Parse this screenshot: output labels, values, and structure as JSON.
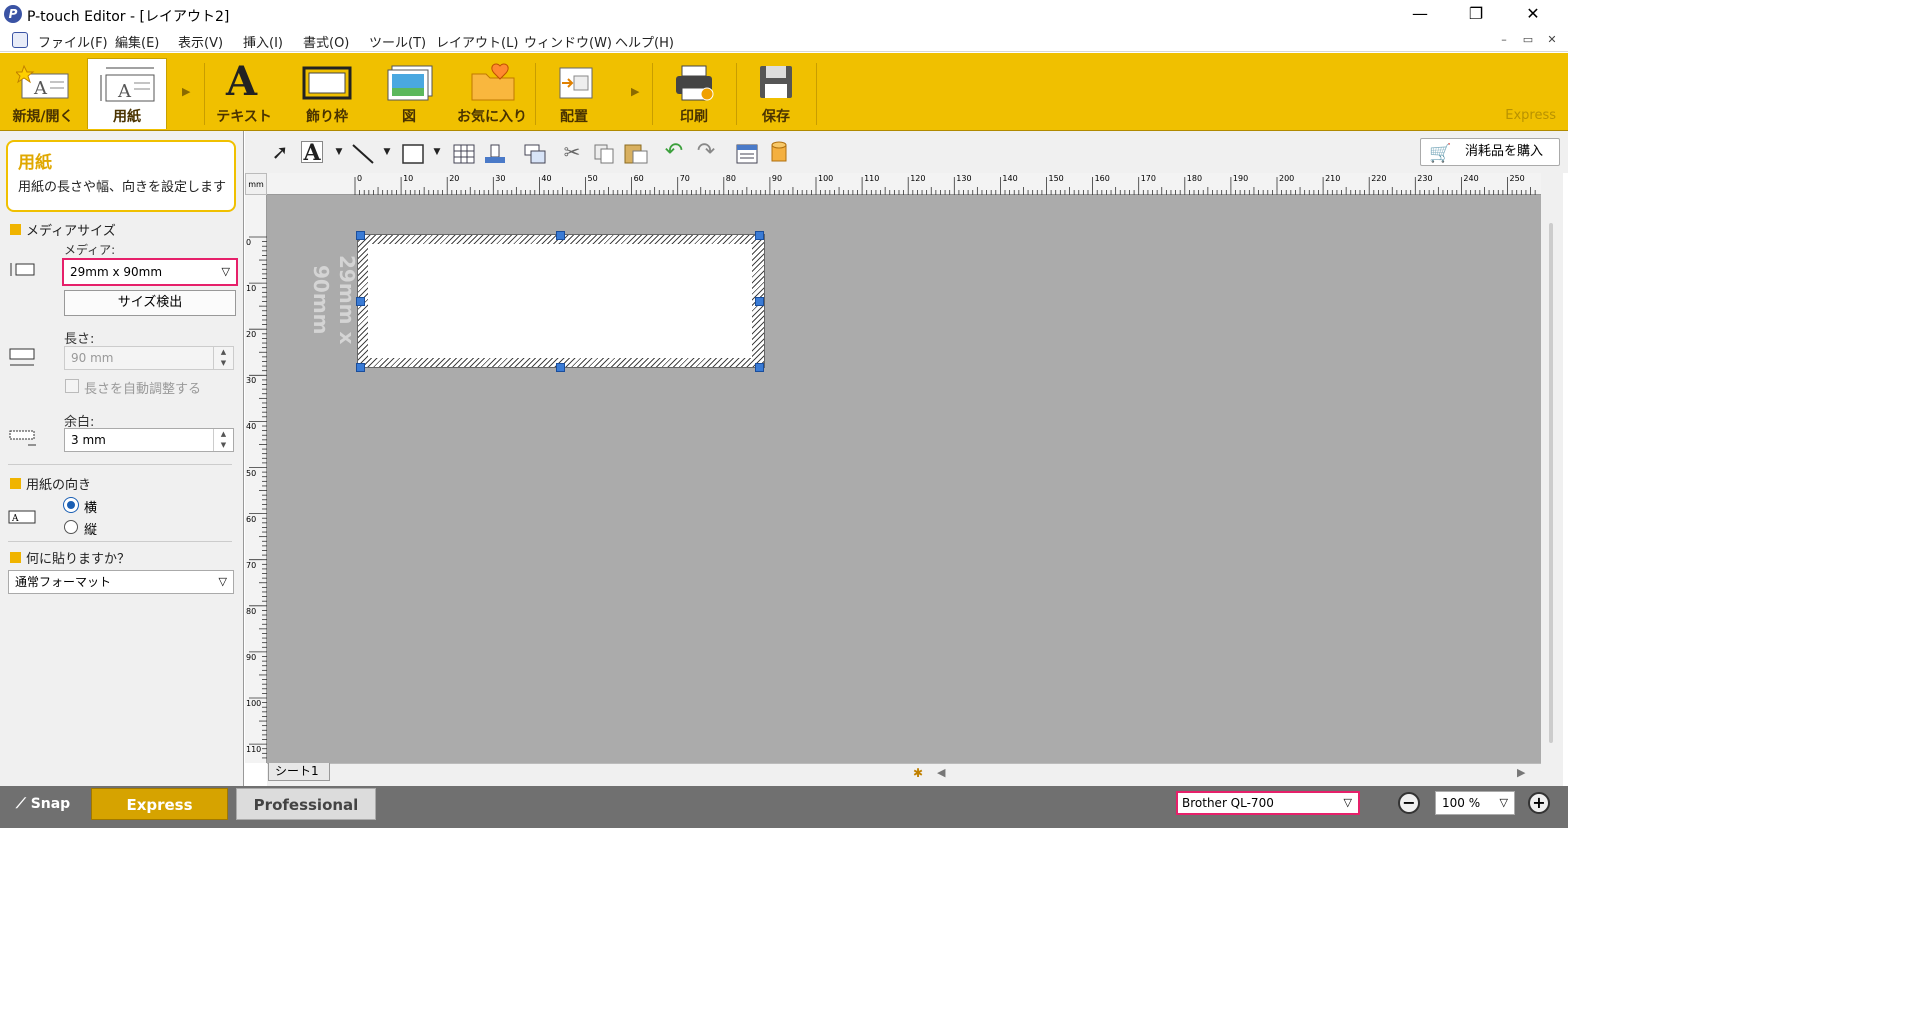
{
  "window": {
    "title": "P-touch Editor - [レイアウト2]",
    "minimize": "—",
    "restore": "❐",
    "close": "✕"
  },
  "menu": {
    "items": [
      "ファイル(F)",
      "編集(E)",
      "表示(V)",
      "挿入(I)",
      "書式(O)",
      "ツール(T)",
      "レイアウト(L)",
      "ウィンドウ(W)",
      "ヘルプ(H)"
    ],
    "mdi_min": "–",
    "mdi_restore": "▭",
    "mdi_close": "✕"
  },
  "ribbon": {
    "new_open": "新規/開く",
    "paper": "用紙",
    "text": "テキスト",
    "frame": "飾り枠",
    "image": "図",
    "favorites": "お気に入り",
    "arrange": "配置",
    "print": "印刷",
    "save": "保存",
    "mode_label": "Express"
  },
  "help": {
    "title": "用紙",
    "description": "用紙の長さや幅、向きを設定します"
  },
  "media_size": {
    "section_title": "メディアサイズ",
    "media_label": "メディア:",
    "media_value": "29mm x 90mm",
    "detect_button": "サイズ検出",
    "length_label": "長さ:",
    "length_value": "90 mm",
    "auto_length_label": "長さを自動調整する",
    "margin_label": "余白:",
    "margin_value": "3 mm"
  },
  "orientation": {
    "section_title": "用紙の向き",
    "landscape": "横",
    "portrait": "縦",
    "selected": "横"
  },
  "paste_target": {
    "section_title": "何に貼りますか？",
    "value": "通常フォーマット"
  },
  "toolbar": {
    "buy_supplies": "消耗品を購入"
  },
  "ruler": {
    "unit": "mm",
    "h_labels": [
      "0",
      "10",
      "20",
      "30",
      "40",
      "50",
      "60",
      "70",
      "80",
      "90",
      "100",
      "110",
      "120",
      "130",
      "140",
      "150",
      "160",
      "170",
      "180",
      "190",
      "200",
      "210",
      "220",
      "230",
      "240",
      "250"
    ],
    "v_labels": [
      "0",
      "10",
      "20",
      "30",
      "40",
      "50",
      "60",
      "70",
      "80",
      "90",
      "100",
      "110"
    ]
  },
  "canvas": {
    "label_text": "29mm x 90mm",
    "sheet_tab": "シート1"
  },
  "statusbar": {
    "snap": "Snap",
    "express": "Express",
    "professional": "Professional",
    "printer": "Brother QL-700",
    "zoom": "100 %"
  },
  "colors": {
    "ribbon": "#f0c000",
    "highlight": "#e6206a",
    "express_active": "#d6a300",
    "canvas_bg": "#ababab"
  },
  "icons": [
    "select-arrow-icon",
    "text-tool-icon",
    "line-tool-icon",
    "rectangle-tool-icon",
    "table-icon",
    "database-icon",
    "object-arrange-icon",
    "cut-icon",
    "copy-icon",
    "paste-icon",
    "undo-icon",
    "redo-icon",
    "property-icon",
    "cylinder-icon",
    "shopping-cart-icon"
  ]
}
